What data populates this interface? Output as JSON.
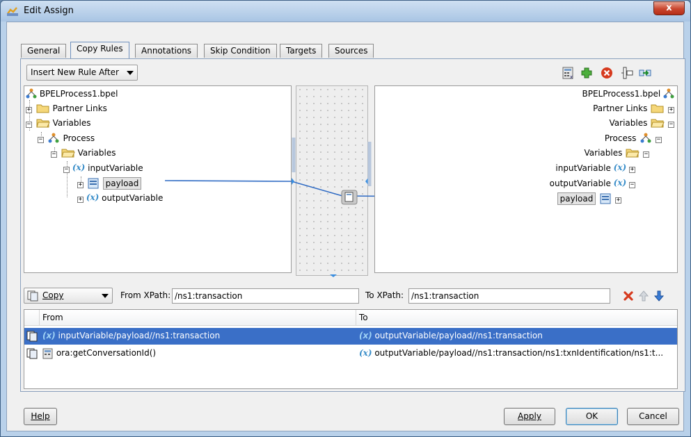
{
  "window": {
    "title": "Edit Assign",
    "close_label": "x"
  },
  "tabs": [
    {
      "label": "General"
    },
    {
      "label": "Copy Rules"
    },
    {
      "label": "Annotations"
    },
    {
      "label": "Skip Condition"
    },
    {
      "label": "Targets"
    },
    {
      "label": "Sources"
    }
  ],
  "active_tab": "Copy Rules",
  "insert_rule": {
    "value": "Insert New Rule After"
  },
  "toolbar_icons": [
    "expression-builder-icon",
    "xml-fragment-icon",
    "delete-icon",
    "xpath-function-icon",
    "auto-map-icon"
  ],
  "source_tree": {
    "root": "BPELProcess1.bpel",
    "partner_links": "Partner Links",
    "variables": "Variables",
    "process": "Process",
    "process_variables": "Variables",
    "input_variable": "inputVariable",
    "payload": "payload",
    "output_variable": "outputVariable"
  },
  "target_tree": {
    "root": "BPELProcess1.bpel",
    "partner_links": "Partner Links",
    "variables": "Variables",
    "process": "Process",
    "process_variables": "Variables",
    "input_variable": "inputVariable",
    "output_variable": "outputVariable",
    "payload": "payload"
  },
  "rule_editor": {
    "operation": "Copy",
    "from_label": "From XPath:",
    "from_value": "/ns1:transaction",
    "to_label": "To XPath:",
    "to_value": "/ns1:transaction"
  },
  "rules_table": {
    "headers": [
      "From",
      "To"
    ],
    "rows": [
      {
        "from": "inputVariable/payload//ns1:transaction",
        "to": "outputVariable/payload//ns1:transaction",
        "selected": true
      },
      {
        "from": "ora:getConversationId()",
        "to": "outputVariable/payload//ns1:transaction/ns1:txnIdentification/ns1:t...",
        "selected": false
      }
    ]
  },
  "buttons": {
    "help": "Help",
    "apply": "Apply",
    "ok": "OK",
    "cancel": "Cancel"
  },
  "colors": {
    "selection": "#3a6fc7",
    "link_line": "#2f6bc4"
  }
}
